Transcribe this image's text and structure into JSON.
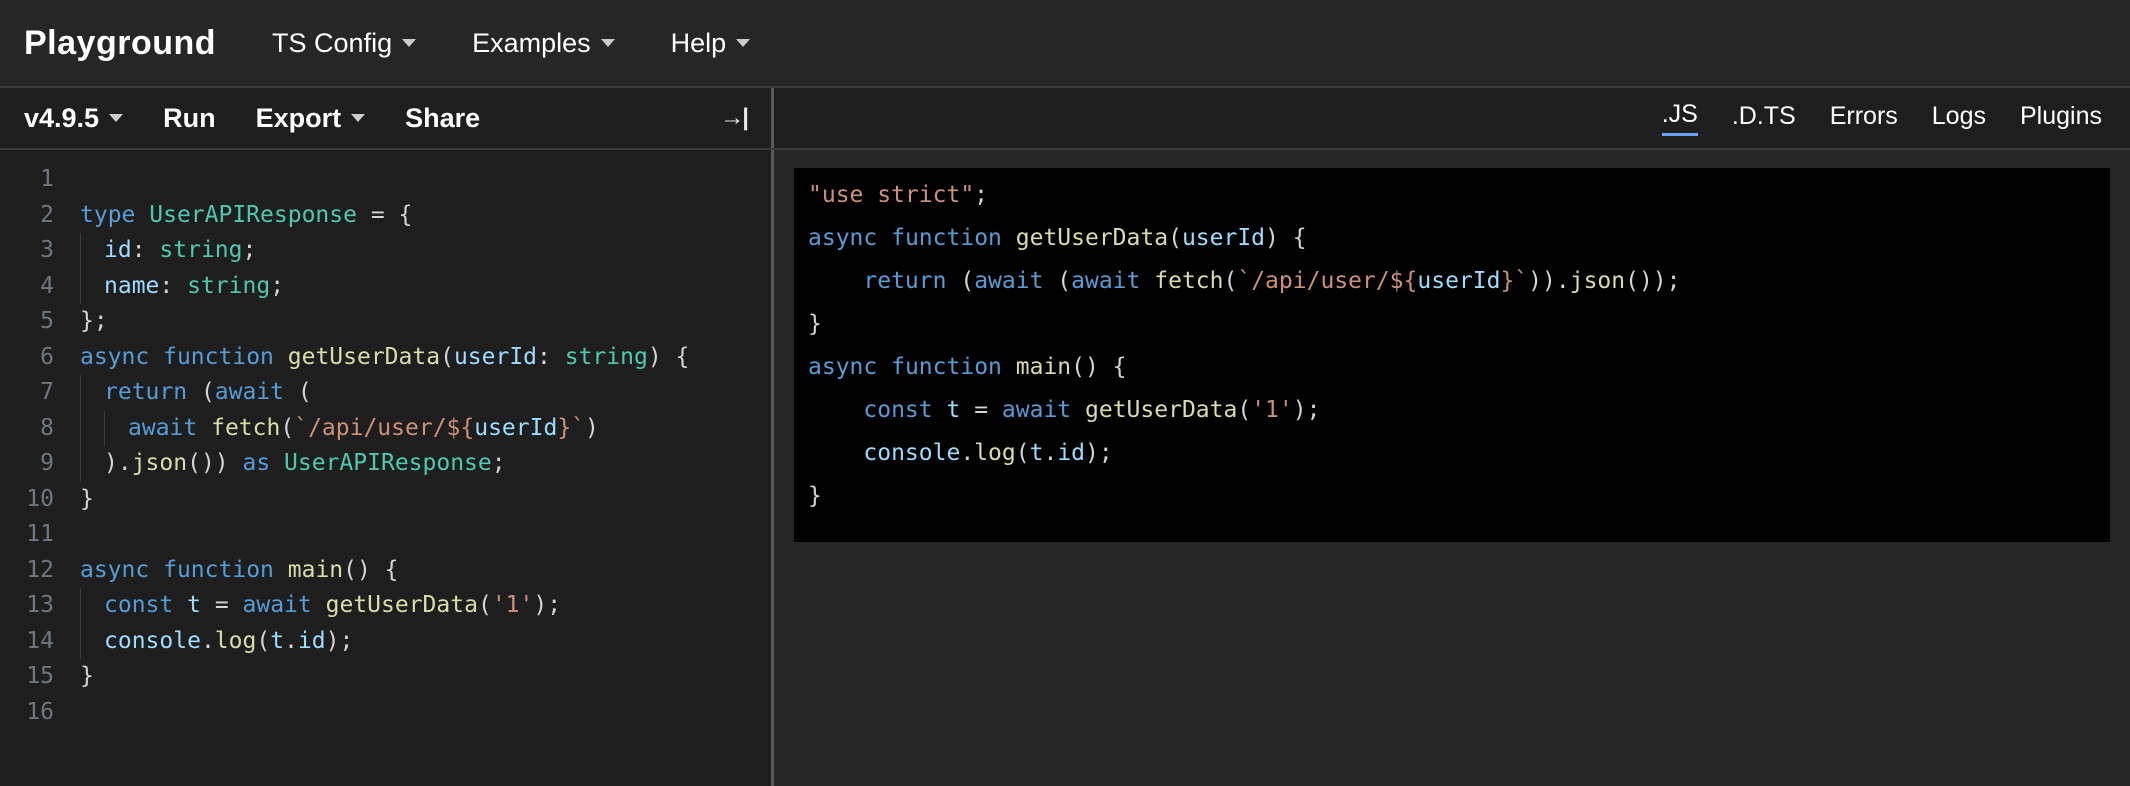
{
  "top_nav": {
    "brand": "Playground",
    "items": [
      {
        "label": "TS Config",
        "dropdown": true
      },
      {
        "label": "Examples",
        "dropdown": true
      },
      {
        "label": "Help",
        "dropdown": true
      }
    ]
  },
  "toolbar": {
    "version": "v4.9.5",
    "run_label": "Run",
    "export_label": "Export",
    "share_label": "Share"
  },
  "output_tabs": {
    "js": ".JS",
    "dts": ".D.TS",
    "errors": "Errors",
    "logs": "Logs",
    "plugins": "Plugins",
    "active": "js"
  },
  "editor": {
    "line_count": 16,
    "tokens": [
      [],
      [
        [
          "kw",
          "type"
        ],
        [
          "op",
          " "
        ],
        [
          "type",
          "UserAPIResponse"
        ],
        [
          "op",
          " = {"
        ]
      ],
      [
        [
          "prop",
          "id"
        ],
        [
          "op",
          ": "
        ],
        [
          "type",
          "string"
        ],
        [
          "op",
          ";"
        ]
      ],
      [
        [
          "prop",
          "name"
        ],
        [
          "op",
          ": "
        ],
        [
          "type",
          "string"
        ],
        [
          "op",
          ";"
        ]
      ],
      [
        [
          "op",
          "};"
        ]
      ],
      [
        [
          "kw",
          "async"
        ],
        [
          "op",
          " "
        ],
        [
          "kw",
          "function"
        ],
        [
          "op",
          " "
        ],
        [
          "fn",
          "getUserData"
        ],
        [
          "op",
          "("
        ],
        [
          "prop",
          "userId"
        ],
        [
          "op",
          ": "
        ],
        [
          "type",
          "string"
        ],
        [
          "op",
          ") {"
        ]
      ],
      [
        [
          "kw",
          "return"
        ],
        [
          "op",
          " ("
        ],
        [
          "kw",
          "await"
        ],
        [
          "op",
          " ("
        ]
      ],
      [
        [
          "kw",
          "await"
        ],
        [
          "op",
          " "
        ],
        [
          "fn",
          "fetch"
        ],
        [
          "op",
          "("
        ],
        [
          "str",
          "`/api/user/${"
        ],
        [
          "prop",
          "userId"
        ],
        [
          "str",
          "}`"
        ],
        [
          "op",
          ")"
        ]
      ],
      [
        [
          "op",
          ")."
        ],
        [
          "fn",
          "json"
        ],
        [
          "op",
          "()) "
        ],
        [
          "kw",
          "as"
        ],
        [
          "op",
          " "
        ],
        [
          "type",
          "UserAPIResponse"
        ],
        [
          "op",
          ";"
        ]
      ],
      [
        [
          "op",
          "}"
        ]
      ],
      [],
      [
        [
          "kw",
          "async"
        ],
        [
          "op",
          " "
        ],
        [
          "kw",
          "function"
        ],
        [
          "op",
          " "
        ],
        [
          "fn",
          "main"
        ],
        [
          "op",
          "() {"
        ]
      ],
      [
        [
          "kw",
          "const"
        ],
        [
          "op",
          " "
        ],
        [
          "prop",
          "t"
        ],
        [
          "op",
          " = "
        ],
        [
          "kw",
          "await"
        ],
        [
          "op",
          " "
        ],
        [
          "fn",
          "getUserData"
        ],
        [
          "op",
          "("
        ],
        [
          "str",
          "'1'"
        ],
        [
          "op",
          ");"
        ]
      ],
      [
        [
          "prop",
          "console"
        ],
        [
          "op",
          "."
        ],
        [
          "fn",
          "log"
        ],
        [
          "op",
          "("
        ],
        [
          "prop",
          "t"
        ],
        [
          "op",
          "."
        ],
        [
          "prop",
          "id"
        ],
        [
          "op",
          ");"
        ]
      ],
      [
        [
          "op",
          "}"
        ]
      ],
      []
    ],
    "indent": [
      0,
      0,
      1,
      1,
      0,
      0,
      1,
      2,
      1,
      0,
      0,
      0,
      1,
      1,
      0,
      0
    ]
  },
  "output": {
    "tokens": [
      [
        [
          "str",
          "\"use strict\""
        ],
        [
          "op",
          ";"
        ]
      ],
      [
        [
          "kw",
          "async"
        ],
        [
          "op",
          " "
        ],
        [
          "kw",
          "function"
        ],
        [
          "op",
          " "
        ],
        [
          "fn",
          "getUserData"
        ],
        [
          "op",
          "("
        ],
        [
          "prop",
          "userId"
        ],
        [
          "op",
          ") {"
        ]
      ],
      [
        [
          "op",
          "    "
        ],
        [
          "kw",
          "return"
        ],
        [
          "op",
          " ("
        ],
        [
          "kw",
          "await"
        ],
        [
          "op",
          " ("
        ],
        [
          "kw",
          "await"
        ],
        [
          "op",
          " "
        ],
        [
          "fn",
          "fetch"
        ],
        [
          "op",
          "("
        ],
        [
          "str",
          "`/api/user/${"
        ],
        [
          "prop",
          "userId"
        ],
        [
          "str",
          "}`"
        ],
        [
          "op",
          "))."
        ],
        [
          "fn",
          "json"
        ],
        [
          "op",
          "());"
        ]
      ],
      [
        [
          "op",
          "}"
        ]
      ],
      [
        [
          "kw",
          "async"
        ],
        [
          "op",
          " "
        ],
        [
          "kw",
          "function"
        ],
        [
          "op",
          " "
        ],
        [
          "fn",
          "main"
        ],
        [
          "op",
          "() {"
        ]
      ],
      [
        [
          "op",
          "    "
        ],
        [
          "kw",
          "const"
        ],
        [
          "op",
          " "
        ],
        [
          "prop",
          "t"
        ],
        [
          "op",
          " = "
        ],
        [
          "kw",
          "await"
        ],
        [
          "op",
          " "
        ],
        [
          "fn",
          "getUserData"
        ],
        [
          "op",
          "("
        ],
        [
          "str",
          "'1'"
        ],
        [
          "op",
          ");"
        ]
      ],
      [
        [
          "op",
          "    "
        ],
        [
          "prop",
          "console"
        ],
        [
          "op",
          "."
        ],
        [
          "fn",
          "log"
        ],
        [
          "op",
          "("
        ],
        [
          "prop",
          "t"
        ],
        [
          "op",
          "."
        ],
        [
          "prop",
          "id"
        ],
        [
          "op",
          ");"
        ]
      ],
      [
        [
          "op",
          "}"
        ]
      ]
    ]
  }
}
